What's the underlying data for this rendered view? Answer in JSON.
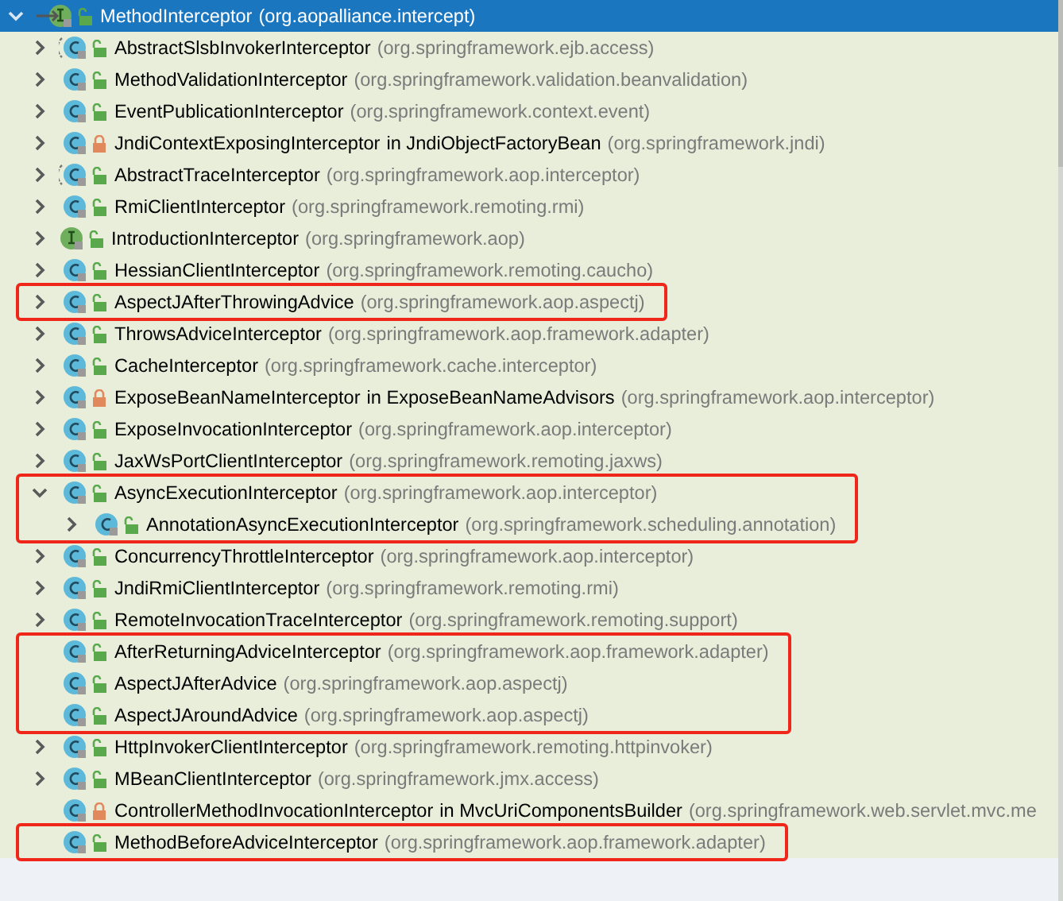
{
  "tree": {
    "name": "MethodInterceptor",
    "package": "(org.aopalliance.intercept)",
    "kind": "interface",
    "locked": false,
    "expanded": true,
    "selected": true,
    "highlighted": false,
    "children": [
      {
        "name": "AbstractSlsbInvokerInterceptor",
        "package": "(org.springframework.ejb.access)",
        "kind": "abstract_class",
        "locked": false,
        "expanded": false,
        "selected": false,
        "highlighted": false
      },
      {
        "name": "MethodValidationInterceptor",
        "package": "(org.springframework.validation.beanvalidation)",
        "kind": "class",
        "locked": false,
        "expanded": false,
        "selected": false,
        "highlighted": false
      },
      {
        "name": "EventPublicationInterceptor",
        "package": "(org.springframework.context.event)",
        "kind": "class",
        "locked": false,
        "expanded": false,
        "selected": false,
        "highlighted": false
      },
      {
        "name": "JndiContextExposingInterceptor",
        "outer": "in JndiObjectFactoryBean",
        "package": "(org.springframework.jndi)",
        "kind": "class",
        "locked": true,
        "expanded": false,
        "selected": false,
        "highlighted": false
      },
      {
        "name": "AbstractTraceInterceptor",
        "package": "(org.springframework.aop.interceptor)",
        "kind": "abstract_class",
        "locked": false,
        "expanded": false,
        "selected": false,
        "highlighted": false
      },
      {
        "name": "RmiClientInterceptor",
        "package": "(org.springframework.remoting.rmi)",
        "kind": "class",
        "locked": false,
        "expanded": false,
        "selected": false,
        "highlighted": false
      },
      {
        "name": "IntroductionInterceptor",
        "package": "(org.springframework.aop)",
        "kind": "interface",
        "locked": false,
        "expanded": false,
        "selected": false,
        "highlighted": false
      },
      {
        "name": "HessianClientInterceptor",
        "package": "(org.springframework.remoting.caucho)",
        "kind": "class",
        "locked": false,
        "expanded": false,
        "selected": false,
        "highlighted": false
      },
      {
        "name": "AspectJAfterThrowingAdvice",
        "package": "(org.springframework.aop.aspectj)",
        "kind": "class",
        "locked": false,
        "expanded": false,
        "selected": false,
        "highlighted": true
      },
      {
        "name": "ThrowsAdviceInterceptor",
        "package": "(org.springframework.aop.framework.adapter)",
        "kind": "class",
        "locked": false,
        "expanded": false,
        "selected": false,
        "highlighted": false
      },
      {
        "name": "CacheInterceptor",
        "package": "(org.springframework.cache.interceptor)",
        "kind": "class",
        "locked": false,
        "expanded": false,
        "selected": false,
        "highlighted": false
      },
      {
        "name": "ExposeBeanNameInterceptor",
        "outer": "in ExposeBeanNameAdvisors",
        "package": "(org.springframework.aop.interceptor)",
        "kind": "class",
        "locked": true,
        "expanded": false,
        "selected": false,
        "highlighted": false
      },
      {
        "name": "ExposeInvocationInterceptor",
        "package": "(org.springframework.aop.interceptor)",
        "kind": "class",
        "locked": false,
        "expanded": false,
        "selected": false,
        "highlighted": false
      },
      {
        "name": "JaxWsPortClientInterceptor",
        "package": "(org.springframework.remoting.jaxws)",
        "kind": "class",
        "locked": false,
        "expanded": false,
        "selected": false,
        "highlighted": false
      },
      {
        "name": "AsyncExecutionInterceptor",
        "package": "(org.springframework.aop.interceptor)",
        "kind": "class",
        "locked": false,
        "expanded": true,
        "selected": false,
        "highlighted": true,
        "children": [
          {
            "name": "AnnotationAsyncExecutionInterceptor",
            "package": "(org.springframework.scheduling.annotation)",
            "kind": "class",
            "locked": false,
            "expanded": false,
            "selected": false,
            "highlighted": false
          }
        ]
      },
      {
        "name": "ConcurrencyThrottleInterceptor",
        "package": "(org.springframework.aop.interceptor)",
        "kind": "class",
        "locked": false,
        "expanded": false,
        "selected": false,
        "highlighted": false
      },
      {
        "name": "JndiRmiClientInterceptor",
        "package": "(org.springframework.remoting.rmi)",
        "kind": "class",
        "locked": false,
        "expanded": false,
        "selected": false,
        "highlighted": false
      },
      {
        "name": "RemoteInvocationTraceInterceptor",
        "package": "(org.springframework.remoting.support)",
        "kind": "class",
        "locked": false,
        "expanded": false,
        "selected": false,
        "highlighted": false
      },
      {
        "name": "AfterReturningAdviceInterceptor",
        "package": "(org.springframework.aop.framework.adapter)",
        "kind": "class",
        "locked": false,
        "selected": false,
        "highlighted": true
      },
      {
        "name": "AspectJAfterAdvice",
        "package": "(org.springframework.aop.aspectj)",
        "kind": "class",
        "locked": false,
        "selected": false,
        "highlighted": true
      },
      {
        "name": "AspectJAroundAdvice",
        "package": "(org.springframework.aop.aspectj)",
        "kind": "class",
        "locked": false,
        "selected": false,
        "highlighted": true
      },
      {
        "name": "HttpInvokerClientInterceptor",
        "package": "(org.springframework.remoting.httpinvoker)",
        "kind": "class",
        "locked": false,
        "expanded": false,
        "selected": false,
        "highlighted": false
      },
      {
        "name": "MBeanClientInterceptor",
        "package": "(org.springframework.jmx.access)",
        "kind": "class",
        "locked": false,
        "expanded": false,
        "selected": false,
        "highlighted": false
      },
      {
        "name": "ControllerMethodInvocationInterceptor",
        "outer": "in MvcUriComponentsBuilder",
        "package": "(org.springframework.web.servlet.mvc.me",
        "kind": "class",
        "locked": true,
        "selected": false,
        "highlighted": false
      },
      {
        "name": "MethodBeforeAdviceInterceptor",
        "package": "(org.springframework.aop.framework.adapter)",
        "kind": "class",
        "locked": false,
        "selected": false,
        "highlighted": true
      }
    ]
  }
}
